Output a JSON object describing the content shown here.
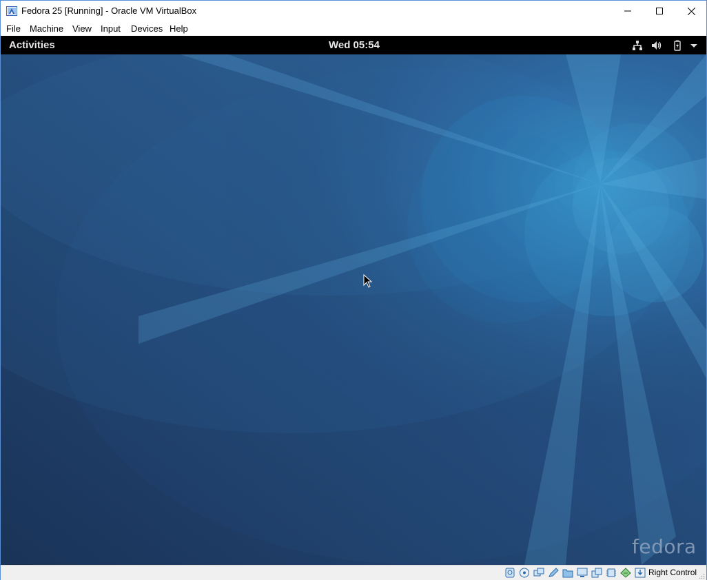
{
  "window": {
    "title": "Fedora 25 [Running] - Oracle VM VirtualBox"
  },
  "menubar": {
    "items": [
      "File",
      "Machine",
      "View",
      "Input",
      "Devices",
      "Help"
    ]
  },
  "gnome": {
    "activities_label": "Activities",
    "clock": "Wed 05:54"
  },
  "wallpaper": {
    "logo_text": "fedora",
    "colors": {
      "dark": "#1a3358",
      "mid": "#2c5a8c",
      "light": "#3c9bd0"
    }
  },
  "statusbar": {
    "host_key_label": "Right Control"
  },
  "icons": {
    "titlebar": [
      "virtualbox-app-icon",
      "minimize-icon",
      "maximize-icon",
      "close-icon"
    ],
    "gnome_tray": [
      "network-wired-icon",
      "volume-icon",
      "battery-icon",
      "dropdown-arrow-icon"
    ],
    "statusbar": [
      "hard-disk-icon",
      "optical-drive-icon",
      "usb-icon",
      "pen-icon",
      "shared-folder-icon",
      "display-icon",
      "network-adapter-icon",
      "cpu-icon",
      "mouse-integration-icon",
      "keyboard-capture-icon"
    ]
  }
}
